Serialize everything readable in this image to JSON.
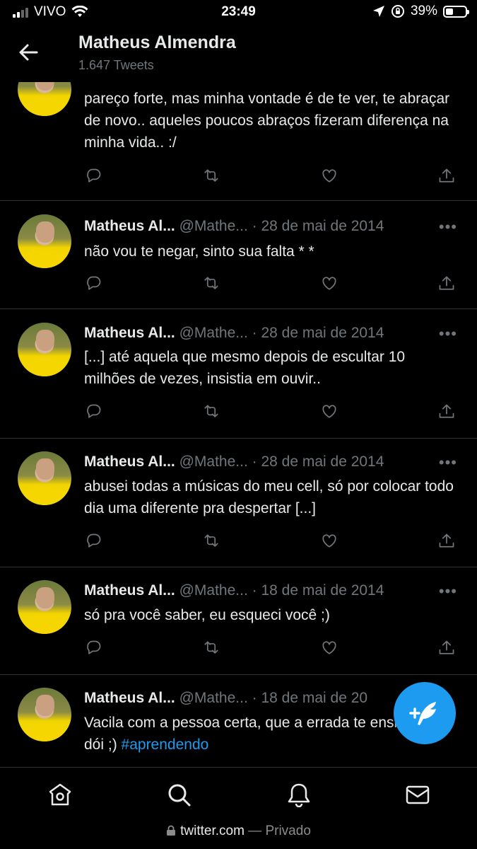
{
  "status": {
    "carrier": "VIVO",
    "time": "23:49",
    "battery": "39%",
    "battery_level": 0.39
  },
  "header": {
    "title": "Matheus Almendra",
    "subtitle": "1.647 Tweets"
  },
  "partial_tweet": {
    "text": "pareço forte, mas minha vontade é de te ver, te abraçar de novo.. aqueles poucos abraços fizeram diferença na minha vida.. :/"
  },
  "tweets": [
    {
      "name": "Matheus Al...",
      "handle": "@Mathe...",
      "date": "· 28 de mai de 2014",
      "text": "não vou te negar, sinto sua falta * *",
      "tag": ""
    },
    {
      "name": "Matheus Al...",
      "handle": "@Mathe...",
      "date": "· 28 de mai de 2014",
      "text": "[...] até aquela que mesmo depois de escultar 10 milhões de vezes, insistia em ouvir..",
      "tag": ""
    },
    {
      "name": "Matheus Al...",
      "handle": "@Mathe...",
      "date": "· 28 de mai de 2014",
      "text": "abusei todas a músicas do meu cell, só por colocar todo dia uma diferente pra despertar [...]",
      "tag": ""
    },
    {
      "name": "Matheus Al...",
      "handle": "@Mathe...",
      "date": "· 18 de mai de 2014",
      "text": "só pra você saber, eu esqueci você ;)",
      "tag": ""
    },
    {
      "name": "Matheus Al...",
      "handle": "@Mathe...",
      "date": "· 18 de mai de 20",
      "text": "Vacila com a pessoa certa, que a errada te ensina como dói ;) ",
      "tag": "#aprendendo"
    }
  ],
  "more_label": "•••",
  "url": {
    "domain": "twitter.com",
    "suffix": " — Privado"
  }
}
